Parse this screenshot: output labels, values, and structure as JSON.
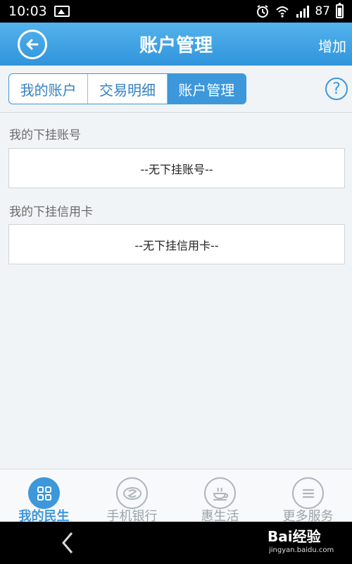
{
  "status_bar": {
    "time": "10:03",
    "battery": "87",
    "left_icon": "image-icon",
    "right_icons": [
      "alarm-icon",
      "wifi-icon",
      "signal-icon",
      "battery-icon"
    ]
  },
  "header": {
    "title": "账户管理",
    "right_action": "增加",
    "back_icon": "back-arrow-circle-icon",
    "background": "#3d97db"
  },
  "tabs": [
    {
      "label": "我的账户",
      "active": false
    },
    {
      "label": "交易明细",
      "active": false
    },
    {
      "label": "账户管理",
      "active": true
    }
  ],
  "help_icon": "help-circle-icon",
  "sections": [
    {
      "title": "我的下挂账号",
      "empty_text": "--无下挂账号--"
    },
    {
      "title": "我的下挂信用卡",
      "empty_text": "--无下挂信用卡--"
    }
  ],
  "bottom_nav": [
    {
      "label": "我的民生",
      "icon": "grid-icon",
      "active": true
    },
    {
      "label": "手机银行",
      "icon": "bank-logo-icon",
      "active": false
    },
    {
      "label": "惠生活",
      "icon": "coffee-icon",
      "active": false
    },
    {
      "label": "更多服务",
      "icon": "menu-icon",
      "active": false
    }
  ],
  "watermark": {
    "logo": "Bai经验",
    "url": "jingyan.baidu.com"
  },
  "colors": {
    "accent": "#3d97db",
    "page_background": "#f1f4f6",
    "inactive_text": "#9aa3a8"
  }
}
